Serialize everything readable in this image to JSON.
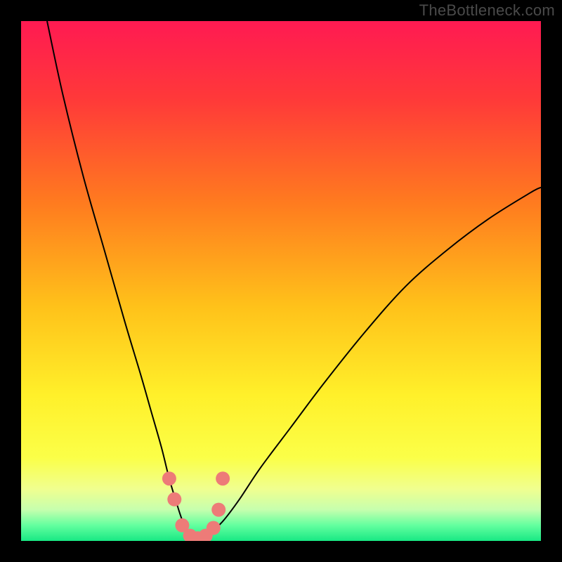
{
  "watermark": "TheBottleneck.com",
  "chart_data": {
    "type": "line",
    "title": "",
    "xlabel": "",
    "ylabel": "",
    "xlim": [
      0,
      100
    ],
    "ylim": [
      0,
      100
    ],
    "legend": false,
    "grid": false,
    "background_gradient": {
      "type": "vertical",
      "stops": [
        {
          "pos": 0.0,
          "color": "#ff1a52"
        },
        {
          "pos": 0.15,
          "color": "#ff3939"
        },
        {
          "pos": 0.35,
          "color": "#ff7b1f"
        },
        {
          "pos": 0.55,
          "color": "#ffc21a"
        },
        {
          "pos": 0.72,
          "color": "#fff02a"
        },
        {
          "pos": 0.84,
          "color": "#fbff48"
        },
        {
          "pos": 0.9,
          "color": "#f0ff8f"
        },
        {
          "pos": 0.94,
          "color": "#c6ffae"
        },
        {
          "pos": 0.97,
          "color": "#63ff9f"
        },
        {
          "pos": 1.0,
          "color": "#18e884"
        }
      ]
    },
    "series": [
      {
        "name": "bottleneck-curve",
        "color": "#000000",
        "width": 2,
        "x": [
          5,
          8,
          12,
          16,
          20,
          23,
          25,
          27,
          28.5,
          30,
          31,
          32,
          33,
          34,
          35,
          36,
          37,
          39,
          42,
          46,
          52,
          58,
          66,
          74,
          82,
          90,
          98,
          100
        ],
        "y": [
          100,
          86,
          70,
          56,
          42,
          32,
          25,
          18,
          12,
          7,
          4,
          2,
          1,
          0.5,
          0.5,
          1,
          2,
          4,
          8,
          14,
          22,
          30,
          40,
          49,
          56,
          62,
          67,
          68
        ]
      },
      {
        "name": "data-points",
        "type": "scatter",
        "color": "#ed7b78",
        "marker_size": 10,
        "x": [
          28.5,
          29.5,
          31,
          32.5,
          34,
          35.5,
          37,
          38,
          38.8
        ],
        "y": [
          12,
          8,
          3,
          1,
          0.5,
          1,
          2.5,
          6,
          12
        ]
      }
    ],
    "annotations": []
  }
}
